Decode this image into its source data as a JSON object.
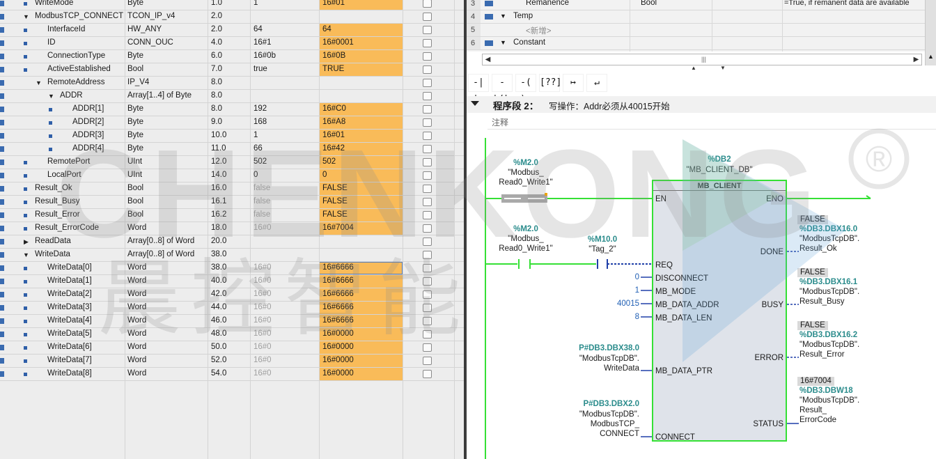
{
  "db_table": {
    "rows": [
      {
        "name": "WriteMode",
        "type": "Byte",
        "offset": "1.0",
        "default": "1",
        "monitor": "16#01",
        "indent": 1,
        "toggle": "",
        "bullet": true,
        "default_gray": false,
        "monitor_orange": true
      },
      {
        "name": "ModbusTCP_CONNECT",
        "type": "TCON_IP_v4",
        "offset": "2.0",
        "default": "",
        "monitor": "",
        "indent": 1,
        "toggle": "▼",
        "bullet": false,
        "default_gray": false,
        "monitor_orange": false
      },
      {
        "name": "InterfaceId",
        "type": "HW_ANY",
        "offset": "2.0",
        "default": "64",
        "monitor": "64",
        "indent": 2,
        "toggle": "",
        "bullet": true,
        "default_gray": false,
        "monitor_orange": true
      },
      {
        "name": "ID",
        "type": "CONN_OUC",
        "offset": "4.0",
        "default": "16#1",
        "monitor": "16#0001",
        "indent": 2,
        "toggle": "",
        "bullet": true,
        "default_gray": false,
        "monitor_orange": true
      },
      {
        "name": "ConnectionType",
        "type": "Byte",
        "offset": "6.0",
        "default": "16#0b",
        "monitor": "16#0B",
        "indent": 2,
        "toggle": "",
        "bullet": true,
        "default_gray": false,
        "monitor_orange": true
      },
      {
        "name": "ActiveEstablished",
        "type": "Bool",
        "offset": "7.0",
        "default": "true",
        "monitor": "TRUE",
        "indent": 2,
        "toggle": "",
        "bullet": true,
        "default_gray": false,
        "monitor_orange": true
      },
      {
        "name": "RemoteAddress",
        "type": "IP_V4",
        "offset": "8.0",
        "default": "",
        "monitor": "",
        "indent": 2,
        "toggle": "▼",
        "bullet": true,
        "default_gray": false,
        "monitor_orange": false
      },
      {
        "name": "ADDR",
        "type": "Array[1..4] of Byte",
        "offset": "8.0",
        "default": "",
        "monitor": "",
        "indent": 3,
        "toggle": "▼",
        "bullet": true,
        "default_gray": false,
        "monitor_orange": false
      },
      {
        "name": "ADDR[1]",
        "type": "Byte",
        "offset": "8.0",
        "default": "192",
        "monitor": "16#C0",
        "indent": 4,
        "toggle": "",
        "bullet": true,
        "default_gray": false,
        "monitor_orange": true
      },
      {
        "name": "ADDR[2]",
        "type": "Byte",
        "offset": "9.0",
        "default": "168",
        "monitor": "16#A8",
        "indent": 4,
        "toggle": "",
        "bullet": true,
        "default_gray": false,
        "monitor_orange": true
      },
      {
        "name": "ADDR[3]",
        "type": "Byte",
        "offset": "10.0",
        "default": "1",
        "monitor": "16#01",
        "indent": 4,
        "toggle": "",
        "bullet": true,
        "default_gray": false,
        "monitor_orange": true
      },
      {
        "name": "ADDR[4]",
        "type": "Byte",
        "offset": "11.0",
        "default": "66",
        "monitor": "16#42",
        "indent": 4,
        "toggle": "",
        "bullet": true,
        "default_gray": false,
        "monitor_orange": true
      },
      {
        "name": "RemotePort",
        "type": "UInt",
        "offset": "12.0",
        "default": "502",
        "monitor": "502",
        "indent": 2,
        "toggle": "",
        "bullet": true,
        "default_gray": false,
        "monitor_orange": true
      },
      {
        "name": "LocalPort",
        "type": "UInt",
        "offset": "14.0",
        "default": "0",
        "monitor": "0",
        "indent": 2,
        "toggle": "",
        "bullet": true,
        "default_gray": false,
        "monitor_orange": true
      },
      {
        "name": "Result_Ok",
        "type": "Bool",
        "offset": "16.0",
        "default": "false",
        "monitor": "FALSE",
        "indent": 1,
        "toggle": "",
        "bullet": true,
        "default_gray": true,
        "monitor_orange": true
      },
      {
        "name": "Result_Busy",
        "type": "Bool",
        "offset": "16.1",
        "default": "false",
        "monitor": "FALSE",
        "indent": 1,
        "toggle": "",
        "bullet": true,
        "default_gray": true,
        "monitor_orange": true
      },
      {
        "name": "Result_Error",
        "type": "Bool",
        "offset": "16.2",
        "default": "false",
        "monitor": "FALSE",
        "indent": 1,
        "toggle": "",
        "bullet": true,
        "default_gray": true,
        "monitor_orange": true
      },
      {
        "name": "Result_ErrorCode",
        "type": "Word",
        "offset": "18.0",
        "default": "16#0",
        "monitor": "16#7004",
        "indent": 1,
        "toggle": "",
        "bullet": true,
        "default_gray": true,
        "monitor_orange": true
      },
      {
        "name": "ReadData",
        "type": "Array[0..8] of Word",
        "offset": "20.0",
        "default": "",
        "monitor": "",
        "indent": 1,
        "toggle": "▶",
        "bullet": false,
        "default_gray": false,
        "monitor_orange": false
      },
      {
        "name": "WriteData",
        "type": "Array[0..8] of Word",
        "offset": "38.0",
        "default": "",
        "monitor": "",
        "indent": 1,
        "toggle": "▼",
        "bullet": false,
        "default_gray": false,
        "monitor_orange": false
      },
      {
        "name": "WriteData[0]",
        "type": "Word",
        "offset": "38.0",
        "default": "16#0",
        "monitor": "16#6666",
        "indent": 2,
        "toggle": "",
        "bullet": true,
        "default_gray": true,
        "monitor_orange": true,
        "selected": true
      },
      {
        "name": "WriteData[1]",
        "type": "Word",
        "offset": "40.0",
        "default": "16#0",
        "monitor": "16#6666",
        "indent": 2,
        "toggle": "",
        "bullet": true,
        "default_gray": true,
        "monitor_orange": true
      },
      {
        "name": "WriteData[2]",
        "type": "Word",
        "offset": "42.0",
        "default": "16#0",
        "monitor": "16#6666",
        "indent": 2,
        "toggle": "",
        "bullet": true,
        "default_gray": true,
        "monitor_orange": true
      },
      {
        "name": "WriteData[3]",
        "type": "Word",
        "offset": "44.0",
        "default": "16#0",
        "monitor": "16#6666",
        "indent": 2,
        "toggle": "",
        "bullet": true,
        "default_gray": true,
        "monitor_orange": true
      },
      {
        "name": "WriteData[4]",
        "type": "Word",
        "offset": "46.0",
        "default": "16#0",
        "monitor": "16#6666",
        "indent": 2,
        "toggle": "",
        "bullet": true,
        "default_gray": true,
        "monitor_orange": true
      },
      {
        "name": "WriteData[5]",
        "type": "Word",
        "offset": "48.0",
        "default": "16#0",
        "monitor": "16#0000",
        "indent": 2,
        "toggle": "",
        "bullet": true,
        "default_gray": true,
        "monitor_orange": true
      },
      {
        "name": "WriteData[6]",
        "type": "Word",
        "offset": "50.0",
        "default": "16#0",
        "monitor": "16#0000",
        "indent": 2,
        "toggle": "",
        "bullet": true,
        "default_gray": true,
        "monitor_orange": true
      },
      {
        "name": "WriteData[7]",
        "type": "Word",
        "offset": "52.0",
        "default": "16#0",
        "monitor": "16#0000",
        "indent": 2,
        "toggle": "",
        "bullet": true,
        "default_gray": true,
        "monitor_orange": true
      },
      {
        "name": "WriteData[8]",
        "type": "Word",
        "offset": "54.0",
        "default": "16#0",
        "monitor": "16#0000",
        "indent": 2,
        "toggle": "",
        "bullet": true,
        "default_gray": true,
        "monitor_orange": true
      }
    ]
  },
  "interface": {
    "rows": [
      {
        "num": "3",
        "toggle": "",
        "name": "Remanence",
        "type": "Bool",
        "comment": "=True, if remanent data are available",
        "icon": true
      },
      {
        "num": "4",
        "toggle": "▼",
        "name": "Temp",
        "type": "",
        "comment": "",
        "icon": true
      },
      {
        "num": "5",
        "toggle": "",
        "name": "<新增>",
        "type": "",
        "comment": "",
        "icon": false,
        "placeholder": true
      },
      {
        "num": "6",
        "toggle": "▼",
        "name": "Constant",
        "type": "",
        "comment": "",
        "icon": true
      }
    ],
    "scroll_grip": "|||"
  },
  "toolbar": {
    "buttons": [
      {
        "label": "-| |-",
        "name": "no-contact-button"
      },
      {
        "label": "-|/|-",
        "name": "nc-contact-button"
      },
      {
        "label": "-( )-",
        "name": "coil-button"
      },
      {
        "label": "[??]",
        "name": "empty-box-button"
      },
      {
        "label": "↦",
        "name": "open-branch-button"
      },
      {
        "label": "↵",
        "name": "close-branch-button"
      }
    ]
  },
  "segment": {
    "title": "程序段 2：",
    "desc": "写操作：Addr必须从40015开始",
    "comment_placeholder": "注释"
  },
  "ladder": {
    "contact1": {
      "addr": "%M2.0",
      "line1": "\"Modbus_",
      "line2": "Read0_Write1\""
    },
    "contact2": {
      "addr": "%M2.0",
      "line1": "\"Modbus_",
      "line2": "Read0_Write1\""
    },
    "contact3": {
      "addr": "%M10.0",
      "line1": "\"Tag_2\""
    },
    "instance": {
      "addr": "%DB2",
      "name": "\"MB_CLIENT_DB\""
    },
    "block_title": "MB_CLIENT",
    "pins_left": [
      "EN",
      "REQ",
      "DISCONNECT",
      "MB_MODE",
      "MB_DATA_ADDR",
      "MB_DATA_LEN",
      "MB_DATA_PTR",
      "CONNECT"
    ],
    "pins_right": [
      "ENO",
      "DONE",
      "BUSY",
      "ERROR",
      "STATUS"
    ],
    "left_values": {
      "disconnect": "0",
      "mb_mode": "1",
      "mb_data_addr": "40015",
      "mb_data_len": "8"
    },
    "ptr": {
      "addr": "P#DB3.DBX38.0",
      "line1": "\"ModbusTcpDB\".",
      "line2": "WriteData"
    },
    "conn": {
      "addr": "P#DB3.DBX2.0",
      "line1": "\"ModbusTcpDB\".",
      "line2": "ModbusTCP_",
      "line3": "CONNECT"
    },
    "done": {
      "value": "FALSE",
      "addr": "%DB3.DBX16.0",
      "line1": "\"ModbusTcpDB\".",
      "line2": "Result_Ok"
    },
    "busy": {
      "value": "FALSE",
      "addr": "%DB3.DBX16.1",
      "line1": "\"ModbusTcpDB\".",
      "line2": "Result_Busy"
    },
    "error": {
      "value": "FALSE",
      "addr": "%DB3.DBX16.2",
      "line1": "\"ModbusTcpDB\".",
      "line2": "Result_Error"
    },
    "status": {
      "value": "16#7004",
      "addr": "%DB3.DBW18",
      "line1": "\"ModbusTcpDB\".",
      "line2": "Result_",
      "line3": "ErrorCode"
    }
  },
  "watermark": {
    "text": "CHENKONG",
    "text_cn": "晨控智能",
    "reg": "®"
  },
  "colors": {
    "monitor_orange": "#f9bb59",
    "rung_green": "#35e035",
    "addr_teal": "#2b8c8c",
    "link_blue": "#2160b5"
  }
}
